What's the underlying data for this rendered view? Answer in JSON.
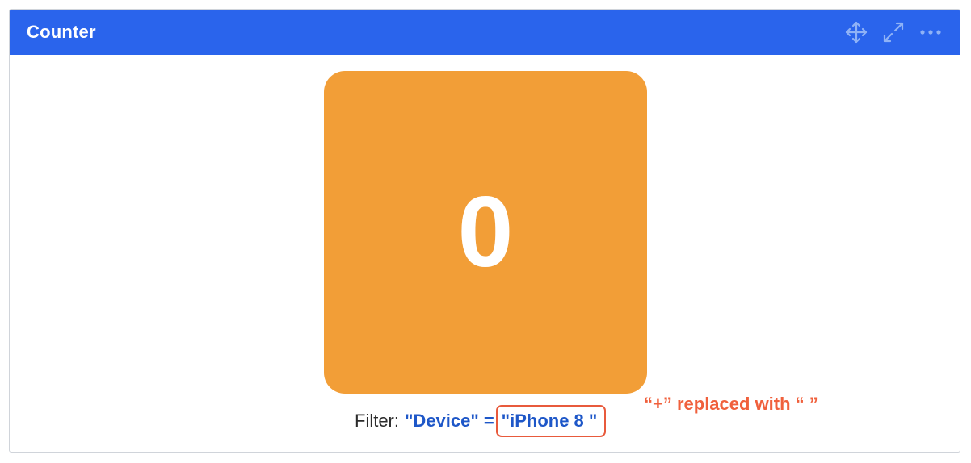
{
  "widget": {
    "title": "Counter",
    "icons": {
      "move": "move-icon",
      "expand": "expand-icon",
      "more": "more-options-icon"
    }
  },
  "counter": {
    "value": "0",
    "tile_color": "#f29e37"
  },
  "filter": {
    "label": "Filter:",
    "key": "\"Device\"",
    "operator": "=",
    "value": "\"iPhone 8 \""
  },
  "annotation": {
    "text": "“+” replaced with “ ”",
    "color": "#f0603c"
  },
  "colors": {
    "header": "#2a64ec",
    "filter_text": "#1e57c8",
    "highlight_border": "#e85a3c"
  }
}
